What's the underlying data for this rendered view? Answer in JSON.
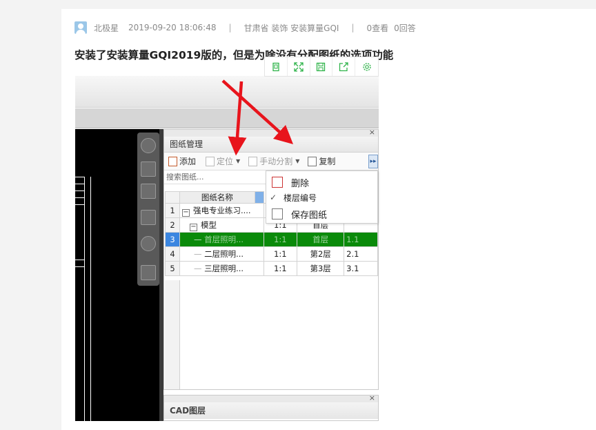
{
  "post": {
    "author": "北极星",
    "datetime": "2019-09-20 18:06:48",
    "separator": "|",
    "category": "甘肃省  装饰 安装算量GQI",
    "views": "0查看",
    "answers": "0回答",
    "title": "安装了安装算量GQI2019版的，但是为啥没有分配图纸的选项功能"
  },
  "image_toolbar": {
    "icons": [
      "fit-page-icon",
      "fullscreen-icon",
      "save-icon",
      "share-icon",
      "settings-icon"
    ],
    "color": "#2fb34a"
  },
  "panel": {
    "title": "图纸管理",
    "close": "×",
    "toolbar": {
      "add": "添加",
      "locate": "定位",
      "manual_split": "手动分割",
      "copy": "复制",
      "more": "▸▸"
    },
    "search_placeholder": "搜索图纸...",
    "table": {
      "header": "图纸名称",
      "rows": [
        {
          "num": "1",
          "name": "强电专业练习....",
          "scale": "",
          "floor": "",
          "code": ""
        },
        {
          "num": "2",
          "name": "模型",
          "scale": "1:1",
          "floor": "首层",
          "code": ""
        },
        {
          "num": "3",
          "name": "首层照明...",
          "scale": "1:1",
          "floor": "首层",
          "code": "1.1"
        },
        {
          "num": "4",
          "name": "二层照明...",
          "scale": "1:1",
          "floor": "第2层",
          "code": "2.1"
        },
        {
          "num": "5",
          "name": "三层照明...",
          "scale": "1:1",
          "floor": "第3层",
          "code": "3.1"
        }
      ]
    }
  },
  "context_menu": {
    "delete": "删除",
    "floor_number": "楼层编号",
    "check": "✓",
    "save": "保存图纸"
  },
  "cad_layer_panel": {
    "title": "CAD图层",
    "close": "×"
  },
  "colors": {
    "selected_row": "#0a8a0a",
    "arrow": "#e8141c",
    "accent": "#2fb34a"
  }
}
